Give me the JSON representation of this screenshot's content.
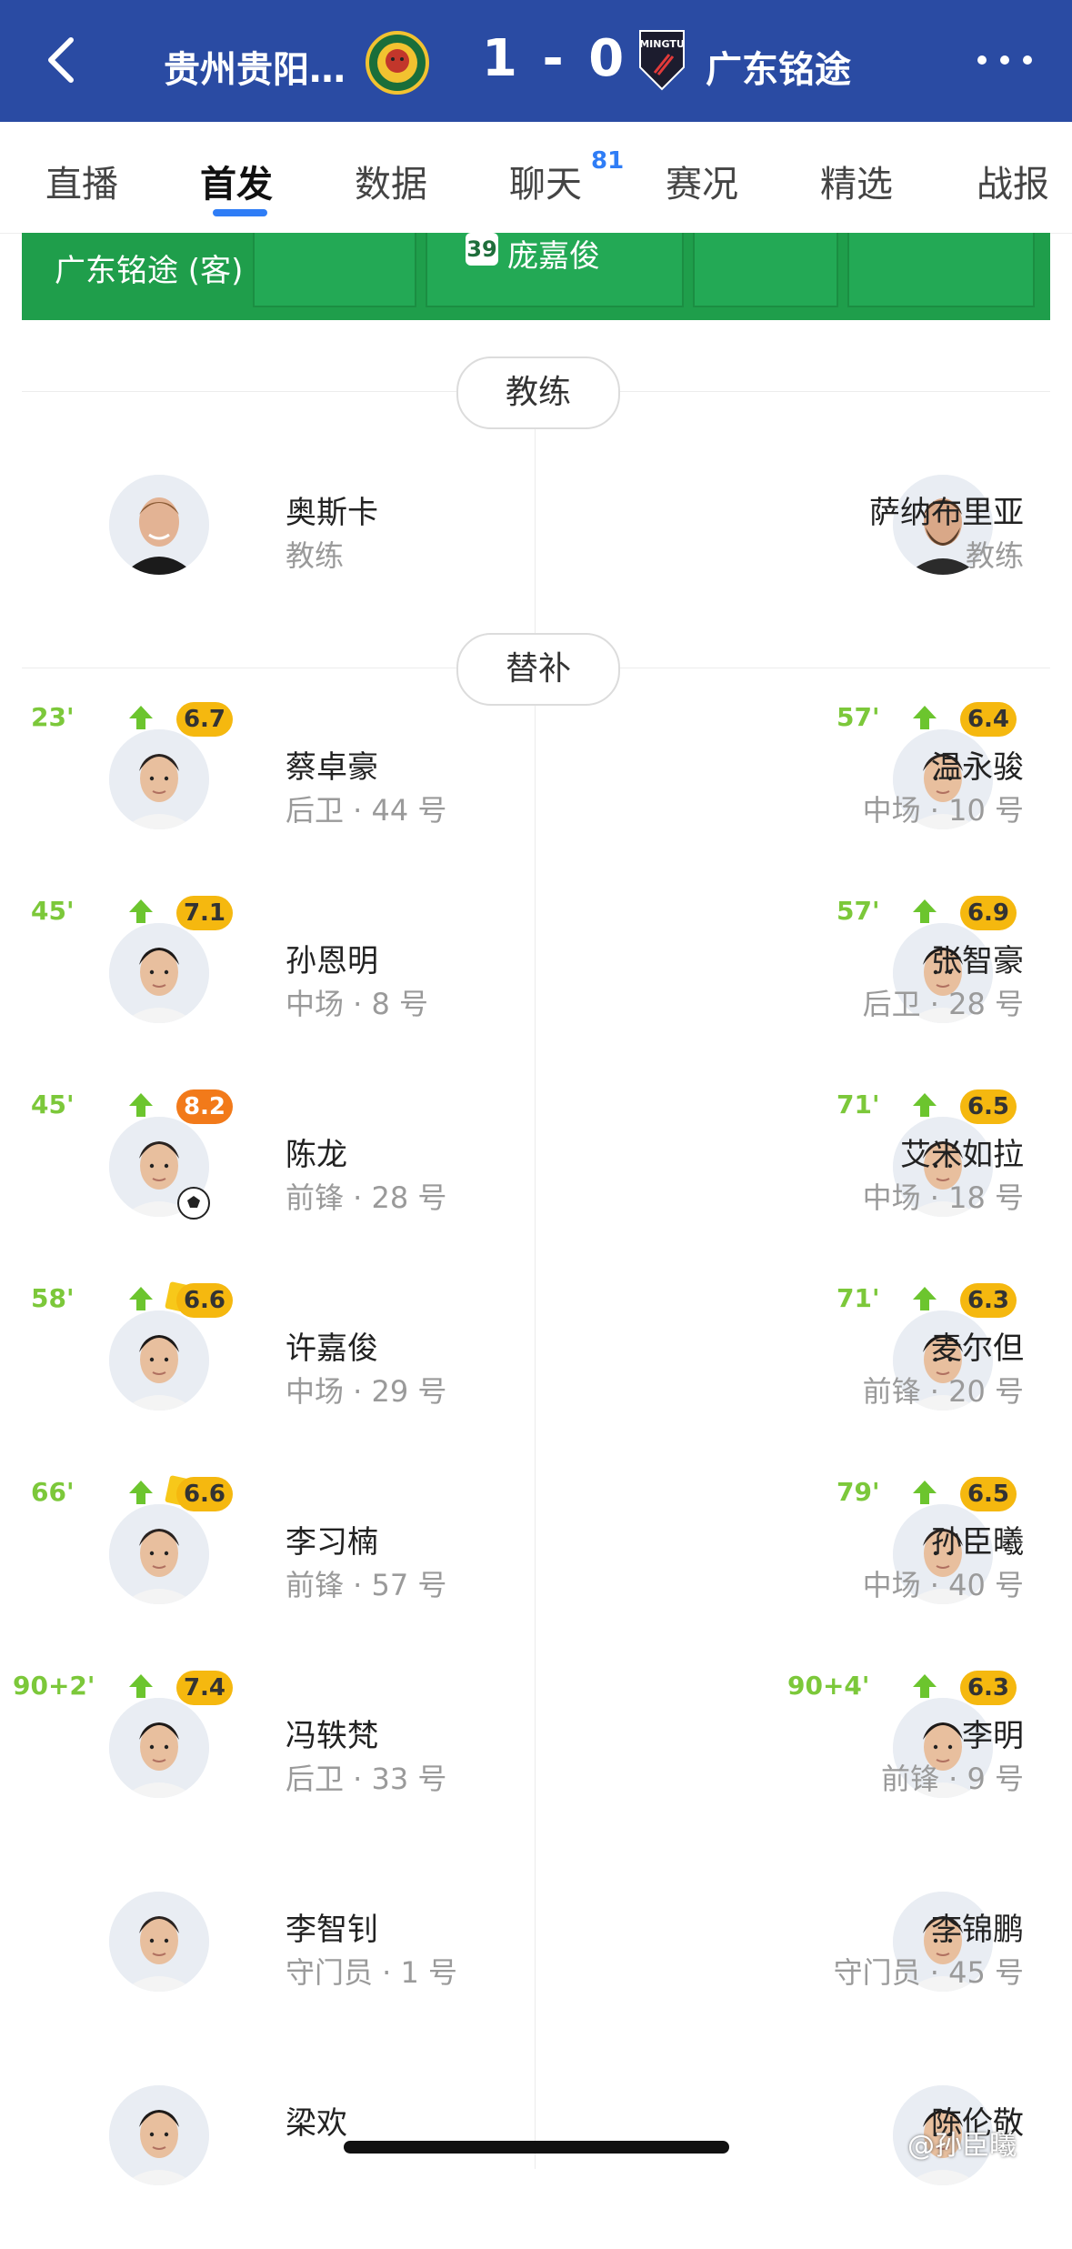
{
  "header": {
    "home_team": "贵州贵阳…",
    "score": "1 - 0",
    "away_team": "广东铭途",
    "bg_color": "#2a4ba3"
  },
  "tabs": [
    {
      "label": "直播"
    },
    {
      "label": "首发",
      "active": true
    },
    {
      "label": "数据"
    },
    {
      "label": "聊天",
      "badge": "81"
    },
    {
      "label": "赛况"
    },
    {
      "label": "精选"
    },
    {
      "label": "战报"
    }
  ],
  "field": {
    "team_label": "广东铭途 (客)",
    "player_number": "39",
    "player_name": "庞嘉俊"
  },
  "coach": {
    "title": "教练",
    "home": {
      "name": "奥斯卡",
      "role": "教练"
    },
    "away": {
      "name": "萨纳布里亚",
      "role": "教练"
    }
  },
  "subs": {
    "title": "替补",
    "home": [
      {
        "minute": "23'",
        "rating": "6.7",
        "name": "蔡卓豪",
        "info": "后卫 · 44 号"
      },
      {
        "minute": "45'",
        "rating": "7.1",
        "name": "孙恩明",
        "info": "中场 · 8 号"
      },
      {
        "minute": "45'",
        "rating": "8.2",
        "name": "陈龙",
        "info": "前锋 · 28 号",
        "goal": true
      },
      {
        "minute": "58'",
        "rating": "6.6",
        "name": "许嘉俊",
        "info": "中场 · 29 号",
        "yellow": true
      },
      {
        "minute": "66'",
        "rating": "6.6",
        "name": "李习楠",
        "info": "前锋 · 57 号",
        "yellow": true
      },
      {
        "minute": "90+2'",
        "rating": "7.4",
        "name": "冯轶梵",
        "info": "后卫 · 33 号"
      },
      {
        "name": "李智钊",
        "info": "守门员 · 1 号"
      },
      {
        "name": "梁欢",
        "info": ""
      }
    ],
    "away": [
      {
        "minute": "57'",
        "rating": "6.4",
        "name": "温永骏",
        "info": "中场 · 10 号"
      },
      {
        "minute": "57'",
        "rating": "6.9",
        "name": "张智豪",
        "info": "后卫 · 28 号"
      },
      {
        "minute": "71'",
        "rating": "6.5",
        "name": "艾米如拉",
        "info": "中场 · 18 号"
      },
      {
        "minute": "71'",
        "rating": "6.3",
        "name": "麦尔但",
        "info": "前锋 · 20 号"
      },
      {
        "minute": "79'",
        "rating": "6.5",
        "name": "孙臣曦",
        "info": "中场 · 40 号"
      },
      {
        "minute": "90+4'",
        "rating": "6.3",
        "name": "李明",
        "info": "前锋 · 9 号"
      },
      {
        "name": "李锦鹏",
        "info": "守门员 · 45 号"
      },
      {
        "name": "陈伦敬",
        "info": ""
      }
    ]
  },
  "watermark": "@孙臣曦",
  "colors": {
    "accent": "#2f7df6",
    "sub_green": "#7cc83a",
    "rating_yellow": "#f5b80f",
    "rating_orange": "#f27a1a"
  }
}
